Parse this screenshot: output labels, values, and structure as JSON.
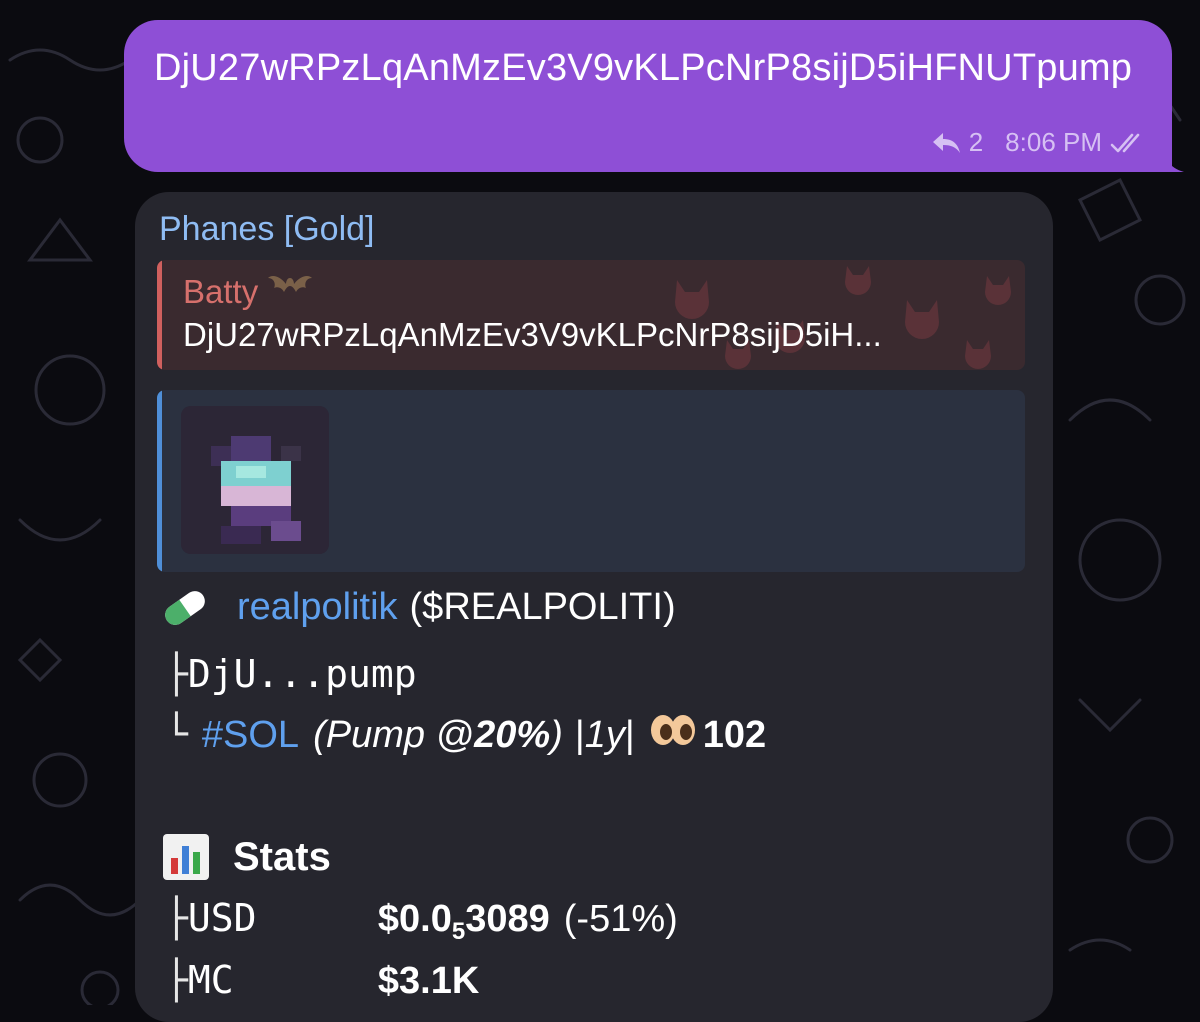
{
  "outgoing": {
    "text": "DjU27wRPzLqAnMzEv3V9vKLPcNrP8sijD5iHFNUTpump",
    "reply_count": "2",
    "time": "8:06 PM",
    "reply_icon": "reply-arrow-icon",
    "status_icon": "double-check-icon"
  },
  "incoming": {
    "sender": "Phanes [Gold]",
    "quote": {
      "author": "Batty",
      "author_emoji": "bat-icon",
      "text": "DjU27wRPzLqAnMzEv3V9vKLPcNrP8sijD5iH..."
    },
    "token": {
      "icon": "pill-icon",
      "name": "realpolitik",
      "symbol": "($REALPOLITI)",
      "address_short": "DjU...pump",
      "chain": "#SOL",
      "platform_open": "(Pump @ ",
      "platform_pct": "20%",
      "platform_close": ")",
      "sep1": "| ",
      "age": "1y",
      "sep2": " |",
      "views_icon": "eyes-icon",
      "views": "102"
    },
    "stats": {
      "title": "Stats",
      "icon": "bar-chart-icon",
      "rows": [
        {
          "key": "USD",
          "value_a": "$0.0",
          "value_sub": "5",
          "value_b": "3089",
          "change": "(-51%)"
        },
        {
          "key": "MC",
          "value_a": "$3.1K",
          "value_sub": "",
          "value_b": "",
          "change": ""
        }
      ]
    }
  },
  "tree_glyphs": {
    "mid": "├",
    "end": "└"
  },
  "colors": {
    "outgoing_bubble": "#8e4fd6",
    "incoming_bubble": "#26262e",
    "sender_name": "#8fbcf3",
    "quote_author": "#d6706c",
    "link_blue": "#5fa0ee"
  }
}
